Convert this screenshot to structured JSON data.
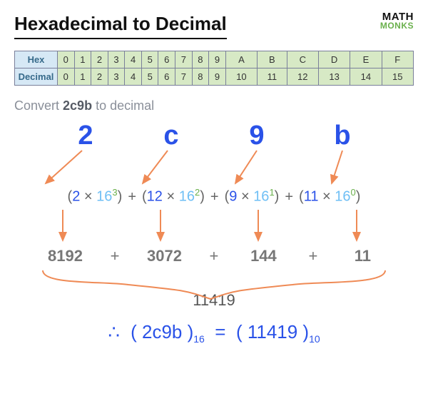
{
  "header": {
    "title": "Hexadecimal to Decimal",
    "logo_top": "MATH",
    "logo_bottom": "MONKS"
  },
  "table": {
    "hex_label": "Hex",
    "dec_label": "Decimal",
    "hex": [
      "0",
      "1",
      "2",
      "3",
      "4",
      "5",
      "6",
      "7",
      "8",
      "9",
      "A",
      "B",
      "C",
      "D",
      "E",
      "F"
    ],
    "dec": [
      "0",
      "1",
      "2",
      "3",
      "4",
      "5",
      "6",
      "7",
      "8",
      "9",
      "10",
      "11",
      "12",
      "13",
      "14",
      "15"
    ]
  },
  "prompt": {
    "lead": "Convert ",
    "value": "2c9b",
    "tail": " to decimal"
  },
  "digits": [
    "2",
    "c",
    "9",
    "b"
  ],
  "terms": [
    {
      "coef": "2",
      "base": "16",
      "exp": "3"
    },
    {
      "coef": "12",
      "base": "16",
      "exp": "2"
    },
    {
      "coef": "9",
      "base": "16",
      "exp": "1"
    },
    {
      "coef": "11",
      "base": "16",
      "exp": "0"
    }
  ],
  "plus": "+",
  "times": "×",
  "products": [
    "8192",
    "3072",
    "144",
    "11"
  ],
  "sum": "11419",
  "conclusion": {
    "therefore": "∴",
    "lhs_inner": "2c9b",
    "lhs_sub": "16",
    "eq": "=",
    "rhs_inner": "11419",
    "rhs_sub": "10"
  }
}
